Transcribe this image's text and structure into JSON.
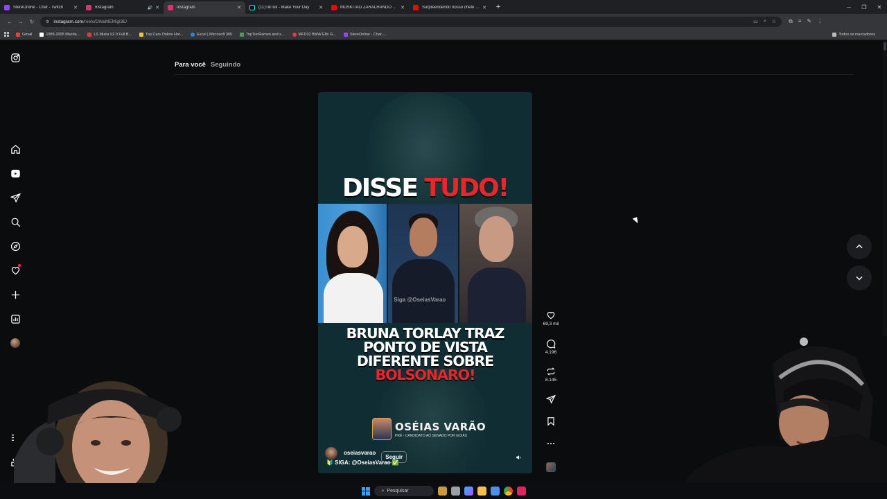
{
  "browser": {
    "tabs": [
      {
        "title": "StereOnline - Chat - Twitch",
        "color": "#9146ff",
        "active": false
      },
      {
        "title": "Instagram",
        "color": "#e1306c",
        "active": false,
        "audio": true
      },
      {
        "title": "Instagram",
        "color": "#e1306c",
        "active": true
      },
      {
        "title": "(11)TikTok - Make Your Day",
        "color": "#111111",
        "active": false
      },
      {
        "title": "MOSKITAO ZARALHANDO AS ...",
        "color": "#ff0000",
        "active": false
      },
      {
        "title": "Surpreendendo nosso chefe co...",
        "color": "#ff0000",
        "active": false
      }
    ],
    "url_host": "instagram.com",
    "url_path": "/reels/DWaMEMigl3E/",
    "bookmarks": [
      {
        "label": "Gmail",
        "color": "#ea4335"
      },
      {
        "label": "1989-2005 Mazda...",
        "color": "#ffffff"
      },
      {
        "label": "LS Miata V2.0 Full B...",
        "color": "#e53935"
      },
      {
        "label": "Top Cars Online Hor...",
        "color": "#fbc02d"
      },
      {
        "label": "Excel | Microsoft 365",
        "color": "#1e88e5"
      },
      {
        "label": "TopTierRamen and s...",
        "color": "#43a047"
      },
      {
        "label": "MFD32 BMW E8x G...",
        "color": "#e53935"
      },
      {
        "label": "StereOnline - Chat -...",
        "color": "#9146ff"
      }
    ],
    "all_bookmarks": "Todos os marcadores"
  },
  "feed": {
    "tab_for_you": "Para você",
    "tab_following": "Seguindo"
  },
  "reel": {
    "headline_white": "DISSE",
    "headline_red": "TUDO!",
    "watermark": "Siga @OseiasVarao",
    "body_line_1": "BRUNA TORLAY TRAZ",
    "body_line_2": "PONTO DE VISTA",
    "body_line_3": "DIFERENTE SOBRE",
    "body_line_red": "BOLSONARO!",
    "brand_name": "OSÉIAS VARÃO",
    "brand_sub": "PRÉ - CANDIDATO AO SENADO POR GOIÁS",
    "author": "oseiasvarao",
    "follow_label": "Seguir",
    "caption": "🔰 SIGA: @OseiasVarao ✅"
  },
  "actions": {
    "likes": "69,3 mil",
    "comments": "4.196",
    "reposts": "8.145"
  },
  "taskbar": {
    "search_label": "Pesquisar"
  }
}
